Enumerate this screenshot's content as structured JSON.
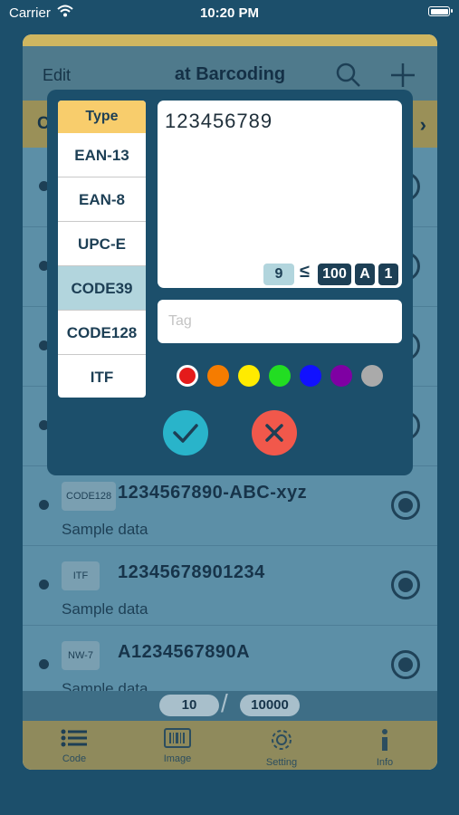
{
  "status_bar": {
    "carrier": "Carrier",
    "time": "10:20 PM"
  },
  "header": {
    "edit_label": "Edit",
    "title": "at Barcoding",
    "column_letter": "C"
  },
  "list": [
    {
      "type": "CODE128",
      "code": "1234567890-ABC-xyz",
      "subtitle": "Sample data"
    },
    {
      "type": "ITF",
      "code": "12345678901234",
      "subtitle": "Sample data"
    },
    {
      "type": "NW-7",
      "code": "A1234567890A",
      "subtitle": "Sample data"
    }
  ],
  "pager": {
    "current": "10",
    "total": "10000"
  },
  "tabbar": {
    "items": [
      {
        "label": "Code"
      },
      {
        "label": "Image"
      },
      {
        "label": "Setting"
      },
      {
        "label": "Info"
      }
    ]
  },
  "dialog": {
    "type_header": "Type",
    "types": [
      "EAN-13",
      "EAN-8",
      "UPC-E",
      "CODE39",
      "CODE128",
      "ITF"
    ],
    "selected_type": "CODE39",
    "code_value": "123456789",
    "char_count": "9",
    "max_count": "100",
    "mode_a": "A",
    "mode_1": "1",
    "tag_placeholder": "Tag",
    "colors": [
      "#e41b1b",
      "#f57c00",
      "#ffeb00",
      "#22dd22",
      "#1111ff",
      "#7f00a3",
      "#aaaaaa"
    ],
    "selected_color": "#e41b1b",
    "ok_color": "#29b4ca",
    "cancel_color": "#f1584b"
  }
}
